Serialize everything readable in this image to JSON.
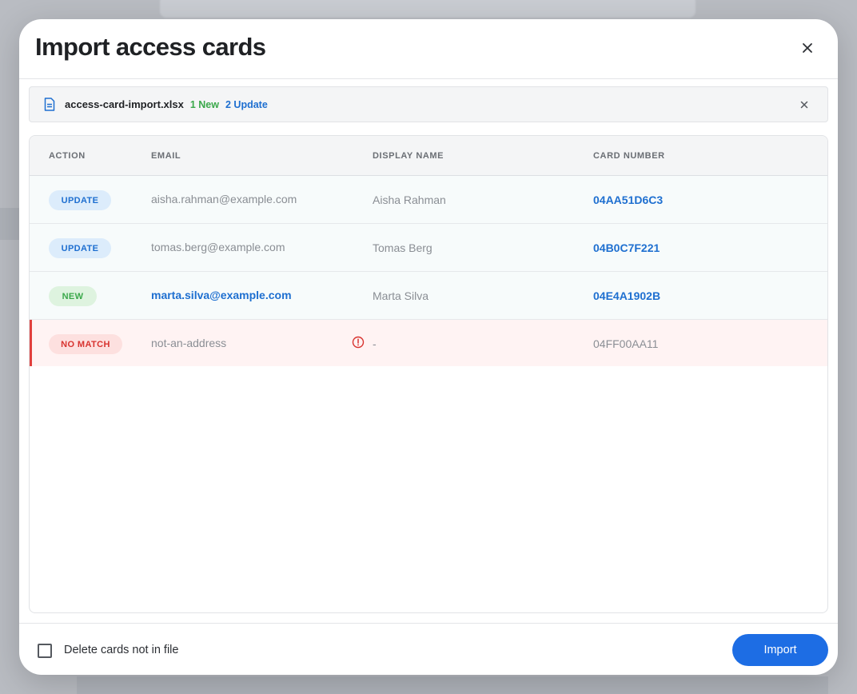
{
  "dialog": {
    "title": "Import access cards"
  },
  "file": {
    "name": "access-card-import.xlsx",
    "new_count": "1 New",
    "update_count": "2 Update"
  },
  "table": {
    "headers": {
      "action": "ACTION",
      "email": "EMAIL",
      "display_name": "DISPLAY NAME",
      "card_number": "CARD NUMBER"
    },
    "rows": [
      {
        "action": "UPDATE",
        "email": "aisha.rahman@example.com",
        "display_name": "Aisha Rahman",
        "card_number": "04AA51D6C3"
      },
      {
        "action": "UPDATE",
        "email": "tomas.berg@example.com",
        "display_name": "Tomas Berg",
        "card_number": "04B0C7F221"
      },
      {
        "action": "NEW",
        "email": "marta.silva@example.com",
        "display_name": "Marta Silva",
        "card_number": "04E4A1902B"
      },
      {
        "action": "NO MATCH",
        "email": "not-an-address",
        "display_name": "-",
        "card_number": "04FF00AA11"
      }
    ]
  },
  "footer": {
    "checkbox_label": "Delete cards not in file",
    "checkbox_checked": false,
    "import_label": "Import"
  },
  "colors": {
    "primary": "#1d6de4",
    "new": "#3aa84a",
    "update": "#1e6fd0",
    "error": "#d8332f"
  },
  "icons": {
    "close": "close-icon",
    "file": "file-document-icon",
    "warning": "alert-circle-icon"
  }
}
